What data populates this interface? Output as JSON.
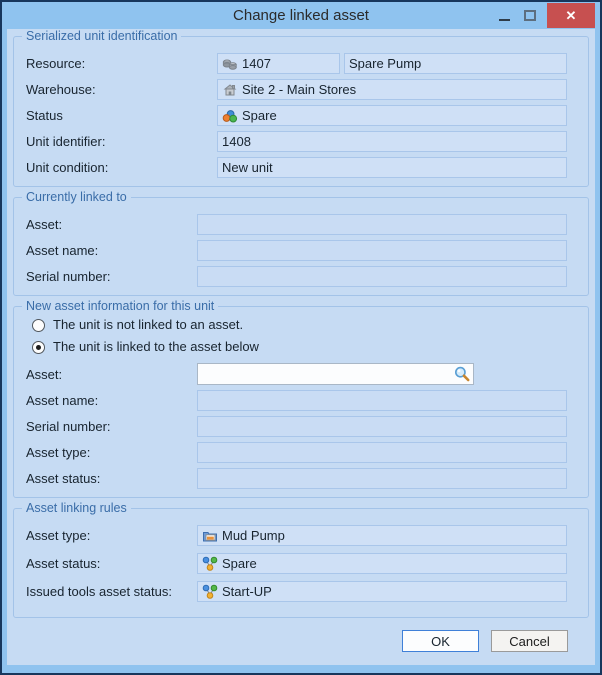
{
  "window": {
    "title": "Change linked asset"
  },
  "colors": {
    "titlebar": "#8fc3ef",
    "client_bg": "#c6dbf3",
    "close_button": "#c75050",
    "group_title": "#3a6da8",
    "ok_border": "#3f80d8"
  },
  "icons": {
    "resource": "machine-parts-icon",
    "warehouse": "building-icon",
    "status": "colored-cubes-icon",
    "asset_type": "folder-image-icon",
    "asset_status": "status-hierarchy-icon",
    "search": "magnifier-icon"
  },
  "groups": {
    "serialized": {
      "title": "Serialized unit identification",
      "resource": {
        "label": "Resource:",
        "id": "1407",
        "name": "Spare Pump"
      },
      "warehouse": {
        "label": "Warehouse:",
        "value": "Site 2 - Main Stores"
      },
      "status": {
        "label": "Status",
        "value": "Spare"
      },
      "unit_identifier": {
        "label": "Unit identifier:",
        "value": "1408"
      },
      "unit_condition": {
        "label": "Unit condition:",
        "value": "New unit"
      }
    },
    "currently_linked": {
      "title": "Currently linked to",
      "asset": {
        "label": "Asset:",
        "value": ""
      },
      "asset_name": {
        "label": "Asset name:",
        "value": ""
      },
      "serial_number": {
        "label": "Serial number:",
        "value": ""
      }
    },
    "new_asset": {
      "title": "New asset information for this unit",
      "radios": [
        {
          "label": "The unit is not linked to an asset.",
          "selected": false
        },
        {
          "label": "The unit is linked to the asset below",
          "selected": true
        }
      ],
      "asset": {
        "label": "Asset:",
        "value": ""
      },
      "asset_name": {
        "label": "Asset name:",
        "value": ""
      },
      "serial_number": {
        "label": "Serial number:",
        "value": ""
      },
      "asset_type": {
        "label": "Asset type:",
        "value": ""
      },
      "asset_status": {
        "label": "Asset status:",
        "value": ""
      }
    },
    "linking_rules": {
      "title": "Asset linking rules",
      "asset_type": {
        "label": "Asset type:",
        "value": "Mud Pump"
      },
      "asset_status": {
        "label": "Asset status:",
        "value": "Spare"
      },
      "issued_tools_status": {
        "label": "Issued tools asset status:",
        "value": "Start-UP"
      }
    }
  },
  "buttons": {
    "ok": "OK",
    "cancel": "Cancel"
  }
}
